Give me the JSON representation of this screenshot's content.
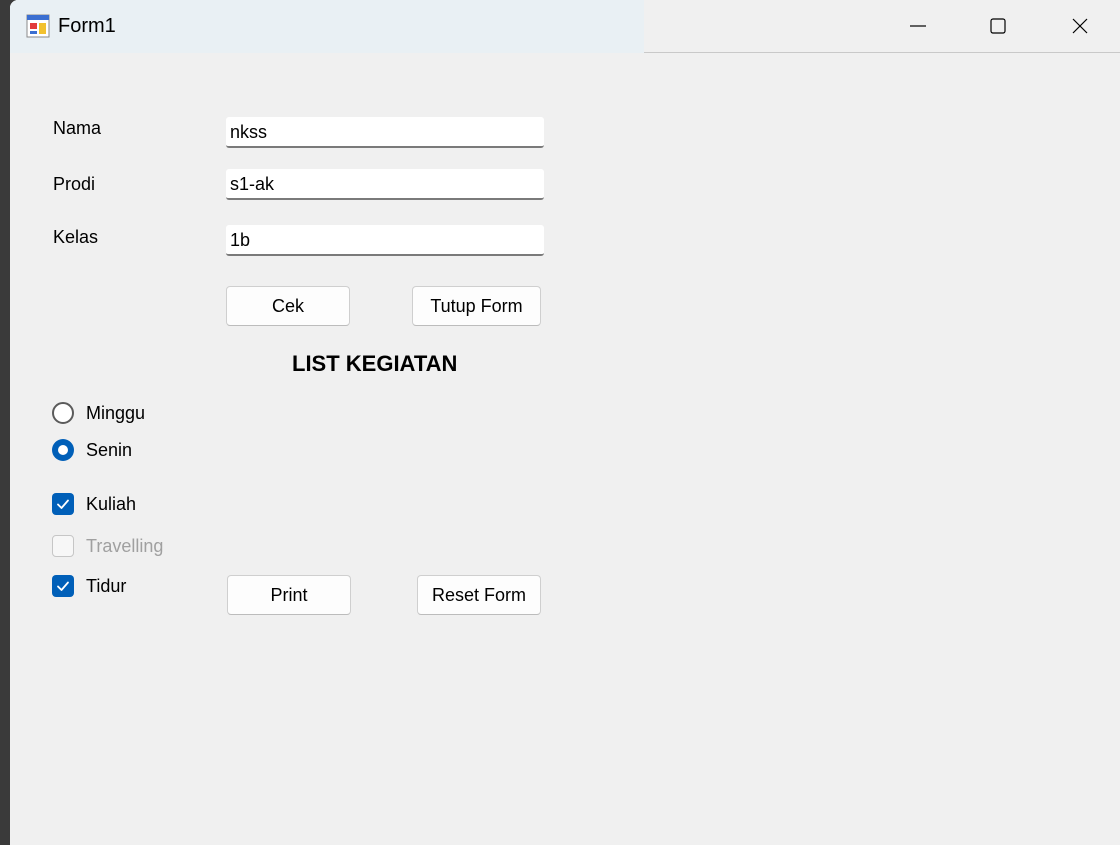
{
  "window": {
    "title": "Form1"
  },
  "icons": {
    "app": "form-app-icon",
    "minimize": "minimize-icon",
    "maximize": "maximize-icon",
    "close": "close-icon",
    "checkmark": "checkmark-icon"
  },
  "form": {
    "fields": [
      {
        "label": "Nama",
        "value": "nkss"
      },
      {
        "label": "Prodi",
        "value": "s1-ak"
      },
      {
        "label": "Kelas",
        "value": "1b"
      }
    ],
    "buttons": {
      "cek": "Cek",
      "tutup": "Tutup Form",
      "print": "Print",
      "reset": "Reset Form"
    },
    "heading": "LIST KEGIATAN",
    "radios": [
      {
        "label": "Minggu",
        "checked": false
      },
      {
        "label": "Senin",
        "checked": true
      }
    ],
    "checkboxes": [
      {
        "label": "Kuliah",
        "checked": true,
        "enabled": true
      },
      {
        "label": "Travelling",
        "checked": false,
        "enabled": false
      },
      {
        "label": "Tidur",
        "checked": true,
        "enabled": true
      }
    ]
  },
  "colors": {
    "accent": "#005fb8",
    "window_bg": "#f0f0f0",
    "disabled_text": "#a0a0a0"
  }
}
